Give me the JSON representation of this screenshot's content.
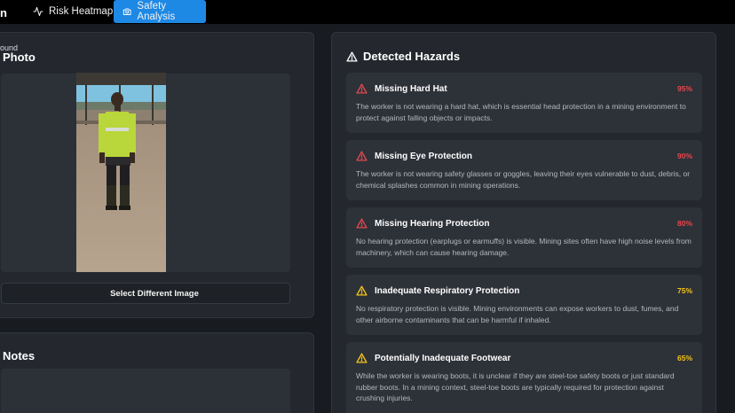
{
  "nav": {
    "brand": "n",
    "tabs": [
      {
        "label": "Risk Heatmap",
        "icon": "activity-icon",
        "active": false
      },
      {
        "label": "Safety Analysis",
        "icon": "camera-icon",
        "active": true
      }
    ]
  },
  "photo_panel": {
    "title": "Photo",
    "select_button": "Select Different Image"
  },
  "notes_panel": {
    "title": "Notes",
    "text": "ound"
  },
  "hazards_panel": {
    "title": "Detected Hazards",
    "items": [
      {
        "title": "Missing Hard Hat",
        "percent": "95%",
        "severity": "high",
        "description": "The worker is not wearing a hard hat, which is essential head protection in a mining environment to protect against falling objects or impacts."
      },
      {
        "title": "Missing Eye Protection",
        "percent": "90%",
        "severity": "high",
        "description": "The worker is not wearing safety glasses or goggles, leaving their eyes vulnerable to dust, debris, or chemical splashes common in mining operations."
      },
      {
        "title": "Missing Hearing Protection",
        "percent": "80%",
        "severity": "high",
        "description": "No hearing protection (earplugs or earmuffs) is visible. Mining sites often have high noise levels from machinery, which can cause hearing damage."
      },
      {
        "title": "Inadequate Respiratory Protection",
        "percent": "75%",
        "severity": "medium",
        "description": "No respiratory protection is visible. Mining environments can expose workers to dust, fumes, and other airborne contaminants that can be harmful if inhaled."
      },
      {
        "title": "Potentially Inadequate Footwear",
        "percent": "65%",
        "severity": "medium",
        "description": "While the worker is wearing boots, it is unclear if they are steel-toe safety boots or just standard rubber boots. In a mining context, steel-toe boots are typically required for protection against crushing injuries."
      }
    ]
  },
  "colors": {
    "high": "#e5484d",
    "medium": "#f5c518",
    "accent": "#1e88e5"
  }
}
